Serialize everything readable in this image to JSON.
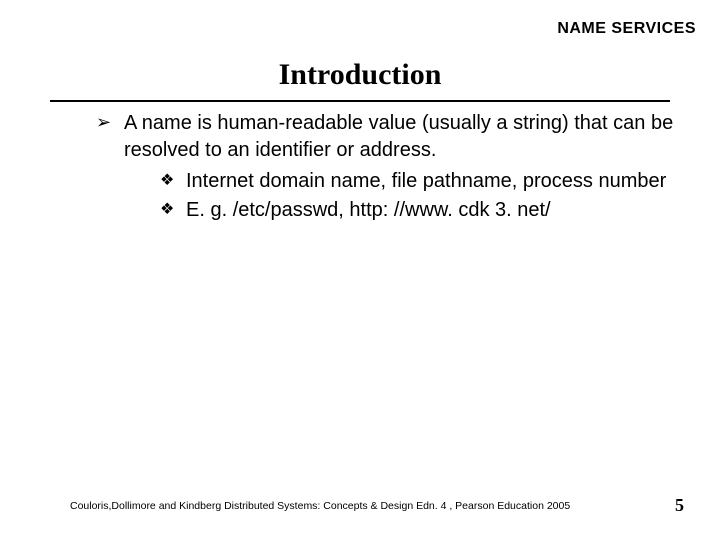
{
  "header": {
    "label": "NAME SERVICES"
  },
  "title": "Introduction",
  "bullets": {
    "level1": {
      "item0": "A name is human-readable value (usually a string) that can be resolved to an identifier or address."
    },
    "level2": {
      "item0": "Internet domain name, file pathname, process number",
      "item1": "E. g. /etc/passwd, http: //www. cdk 3. net/"
    }
  },
  "footer": {
    "citation": "Couloris,Dollimore and Kindberg  Distributed Systems: Concepts & Design  Edn. 4 , Pearson Education 2005",
    "page_number": "5"
  },
  "icons": {
    "arrow_bullet": "➢",
    "diamond_bullet": "❖"
  }
}
